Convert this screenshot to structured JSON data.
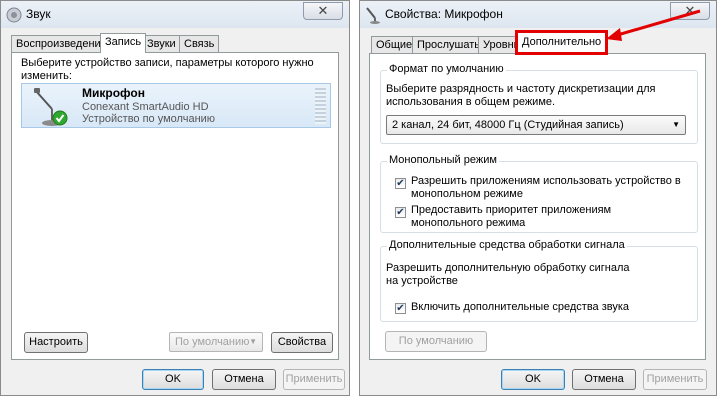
{
  "left_window": {
    "title": "Звук",
    "close_symbol": "✕",
    "tabs": [
      {
        "label": "Воспроизведение"
      },
      {
        "label": "Запись"
      },
      {
        "label": "Звуки"
      },
      {
        "label": "Связь"
      }
    ],
    "instruction": "Выберите устройство записи, параметры которого нужно изменить:",
    "device": {
      "name": "Микрофон",
      "driver": "Conexant SmartAudio HD",
      "status": "Устройство по умолчанию",
      "icon": "microphone-icon"
    },
    "configure_button": "Настроить",
    "default_select": "По умолчанию",
    "properties_button": "Свойства",
    "ok_button": "OK",
    "cancel_button": "Отмена",
    "apply_button": "Применить"
  },
  "right_window": {
    "title": "Свойства: Микрофон",
    "close_symbol": "✕",
    "tabs": [
      {
        "label": "Общие"
      },
      {
        "label": "Прослушать"
      },
      {
        "label": "Уровни"
      },
      {
        "label": "Дополнительно"
      }
    ],
    "default_format": {
      "group_title": "Формат по умолчанию",
      "description": "Выберите разрядность и частоту дискретизации для использования в общем режиме.",
      "selected": "2 канал, 24 бит, 48000 Гц (Студийная запись)"
    },
    "exclusive_mode": {
      "group_title": "Монопольный режим",
      "allow_label": "Разрешить приложениям использовать устройство в монопольном режиме",
      "allow_checked": true,
      "priority_label": "Предоставить приоритет приложениям монопольного режима",
      "priority_checked": true
    },
    "enhancements": {
      "group_title": "Дополнительные средства обработки сигнала",
      "description": "Разрешить дополнительную обработку сигнала на устройстве",
      "enable_label": "Включить дополнительные средства звука",
      "enable_checked": true
    },
    "restore_defaults_button": "По умолчанию",
    "ok_button": "OK",
    "cancel_button": "Отмена",
    "apply_button": "Применить"
  },
  "colors": {
    "annotation_red": "#e30000",
    "check_green": "#2fa82f"
  }
}
